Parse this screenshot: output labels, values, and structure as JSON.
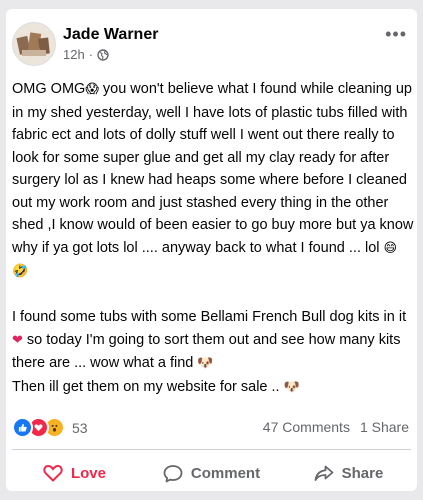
{
  "post": {
    "author": "Jade Warner",
    "time": "12h",
    "separator": "·",
    "more_label": "•••",
    "paragraph1_a": "OMG OMG",
    "paragraph1_b": " you won't believe what I found while cleaning up in my shed yesterday,  well I have lots of plastic tubs filled with fabric  ect and lots of dolly stuff well  I went out there really to look for some super glue and get all my clay ready for after surgery lol as  I knew had heaps some where before I cleaned out my work room and just stashed every thing in the other shed ,I know would of been easier to go buy more but ya know why if ya got lots lol ....  anyway back to what I found ... lol ",
    "paragraph2_a": " I found some tubs with  some Bellami French Bull dog kits in it ",
    "paragraph2_b": " so today I'm going to sort them out and see how many kits there are  ... wow what a find ",
    "paragraph3": " Then ill get them on my website  for sale .. ",
    "emojis": {
      "scream": "😱",
      "grin": "😄",
      "rofl": "🤣",
      "heart": "❤",
      "dog": "🐶"
    }
  },
  "engagement": {
    "reaction_count": "53",
    "comments": "47 Comments",
    "shares": "1 Share"
  },
  "actions": {
    "love_label": "Love",
    "comment_label": "Comment",
    "share_label": "Share"
  },
  "colors": {
    "love": "#f02849",
    "like": "#1877f2",
    "muted": "#65676b"
  }
}
